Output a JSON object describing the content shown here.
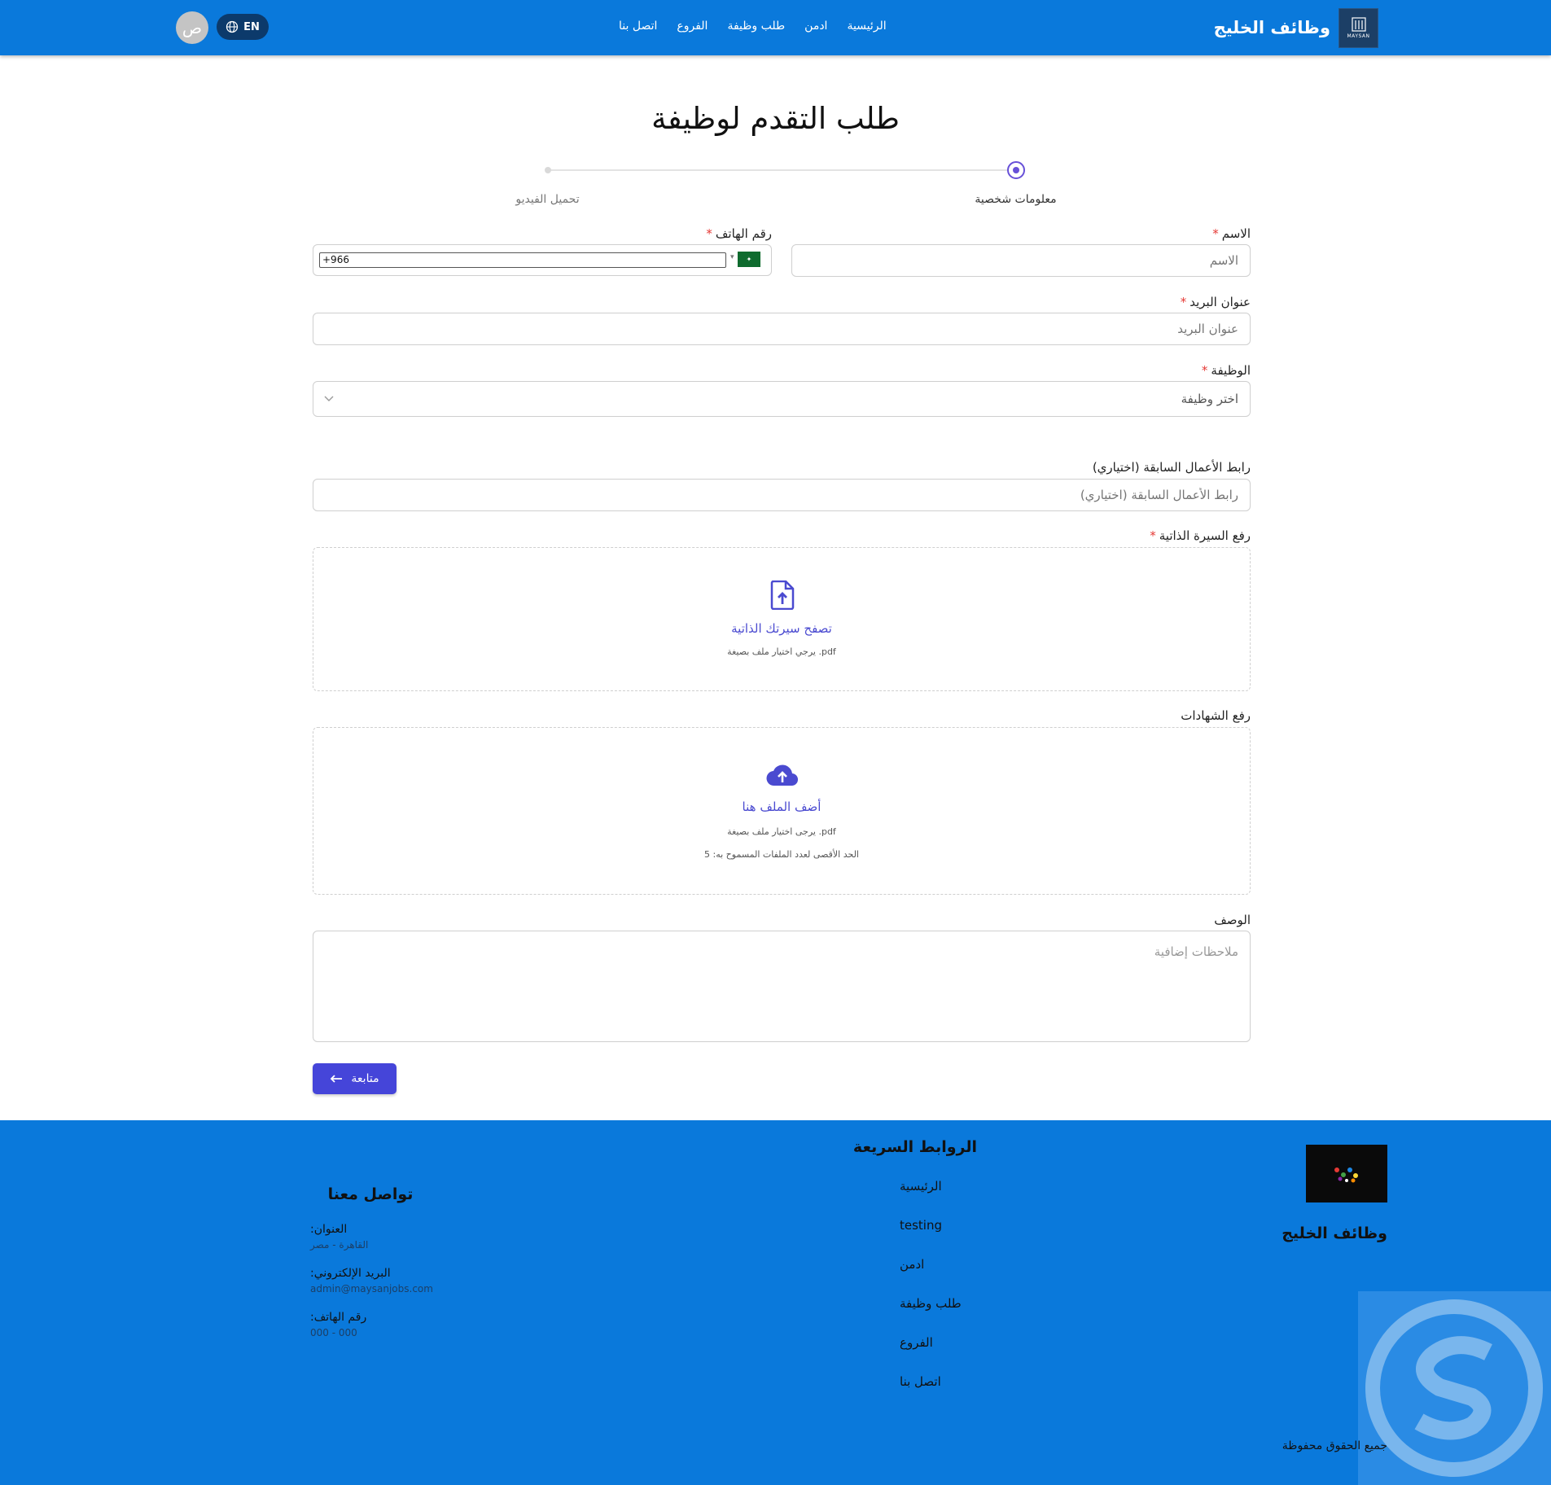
{
  "header": {
    "brand_name": "وظائف الخليج",
    "logo_text": "MAYSAN",
    "nav": [
      "الرئيسية",
      "ادمن",
      "طلب وظيفة",
      "الفروع",
      "اتصل بنا"
    ],
    "lang_label": "EN",
    "avatar_initial": "ص"
  },
  "form": {
    "title": "طلب التقدم لوظيفة",
    "steps": [
      "معلومات شخصية",
      "تحميل الفيديو"
    ],
    "active_step": 1,
    "name": {
      "label": "الاسم",
      "placeholder": "الاسم"
    },
    "phone": {
      "label": "رقم الهاتف",
      "value": "+966",
      "country_icon": "saudi-flag-icon"
    },
    "email": {
      "label": "عنوان البريد",
      "placeholder": "عنوان البريد"
    },
    "job": {
      "label": "الوظيفة",
      "selected": "اختر وظيفة"
    },
    "portfolio": {
      "label": "رابط الأعمال السابقة (اختياري)",
      "placeholder": "رابط الأعمال السابقة (اختياري)"
    },
    "cv": {
      "label": "رفع السيرة الذاتية",
      "title": "تصفح سيرتك الذاتية",
      "hint": "يرجي اختيار ملف بصيغة .pdf"
    },
    "certificates": {
      "label": "رفع الشهادات",
      "title": "أضف الملف هنا",
      "hint": "يرجى اختيار ملف بصيغة .pdf",
      "limit": "الحد الأقصى لعدد الملفات المسموح به: 5"
    },
    "description": {
      "label": "الوصف",
      "placeholder": "ملاحظات إضافية"
    },
    "next_button": "متابعة"
  },
  "footer": {
    "brand_name": "وظائف الخليج",
    "links_title": "الروابط السريعة",
    "links": [
      "الرئيسية",
      "testing",
      "ادمن",
      "طلب وظيفة",
      "الفروع",
      "اتصل بنا"
    ],
    "contact_title": "تواصل معنا",
    "address_label": "العنوان:",
    "address_value": "القاهرة - مصر",
    "email_label": "البريد الإلكتروني:",
    "email_value": "admin@maysanjobs.com",
    "phone_label": "رقم الهاتف:",
    "phone_value": "000 - 000",
    "copyright": "جميع الحقوق محفوظة"
  },
  "colors": {
    "primary": "#0a79db",
    "accent": "#4545d9",
    "step_active": "#6750d8",
    "required": "#e53935"
  }
}
